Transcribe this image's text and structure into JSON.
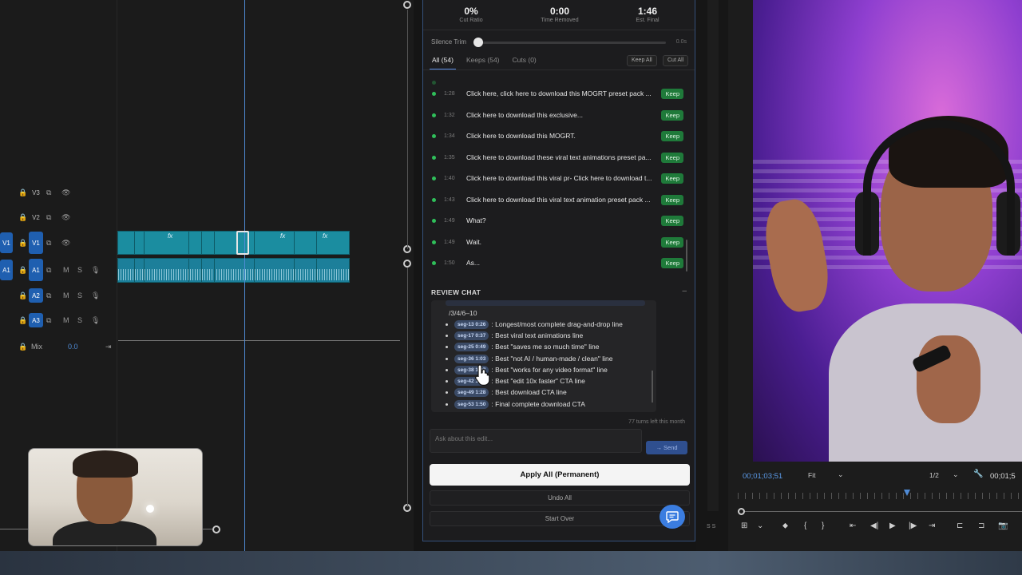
{
  "timeline": {
    "tracks": [
      {
        "id": "V3",
        "name": "V3"
      },
      {
        "id": "V2",
        "name": "V2"
      },
      {
        "id": "V1",
        "name": "V1",
        "target": "V1"
      },
      {
        "id": "A1",
        "name": "A1",
        "target": "A1",
        "m": "M",
        "s": "S"
      },
      {
        "id": "A2",
        "name": "A2",
        "m": "M",
        "s": "S"
      },
      {
        "id": "A3",
        "name": "A3",
        "m": "M",
        "s": "S"
      }
    ],
    "mix_label": "Mix",
    "mix_value": "0.0",
    "fx_label": "fx"
  },
  "panel": {
    "stats": [
      {
        "value": "0%",
        "label": "Cut Ratio"
      },
      {
        "value": "0:00",
        "label": "Time Removed"
      },
      {
        "value": "1:46",
        "label": "Est. Final"
      }
    ],
    "silence_trim_label": "Silence Trim",
    "silence_trim_value": "0.0s",
    "tabs": [
      "All (54)",
      "Keeps (54)",
      "Cuts (0)"
    ],
    "keep_all_label": "Keep All",
    "cut_all_label": "Cut All",
    "segments": [
      {
        "time": "1:28",
        "text": "Click here, click here to download this MOGRT preset pack ...",
        "status": "Keep"
      },
      {
        "time": "1:32",
        "text": "Click here to download this exclusive...",
        "status": "Keep"
      },
      {
        "time": "1:34",
        "text": "Click here to download this MOGRT.",
        "status": "Keep"
      },
      {
        "time": "1:35",
        "text": "Click here to download these viral text animations preset pa...",
        "status": "Keep"
      },
      {
        "time": "1:40",
        "text": "Click here to download this viral pr- Click here to download t...",
        "status": "Keep"
      },
      {
        "time": "1:43",
        "text": "Click here to download this viral text animation preset pack ...",
        "status": "Keep"
      },
      {
        "time": "1:49",
        "text": "What?",
        "status": "Keep"
      },
      {
        "time": "1:49",
        "text": "Wait.",
        "status": "Keep"
      },
      {
        "time": "1:50",
        "text": "As...",
        "status": "Keep"
      }
    ],
    "review_chat_title": "REVIEW CHAT",
    "review_chat_collapse": "–",
    "chat_intro": "/3/4/6–10",
    "chat_items": [
      {
        "chip": "seg-13 0:26",
        "text": ": Longest/most complete drag-and-drop line"
      },
      {
        "chip": "seg-17 0:37",
        "text": ": Best viral text animations line"
      },
      {
        "chip": "seg-25 0:49",
        "text": ": Best \"saves me so much time\" line"
      },
      {
        "chip": "seg-36 1:03",
        "text": ": Best \"not AI / human-made / clean\" line"
      },
      {
        "chip": "seg-38 1:07",
        "text": ": Best \"works for any video format\" line"
      },
      {
        "chip": "seg-42 1:15",
        "text": ": Best \"edit 10x faster\" CTA line"
      },
      {
        "chip": "seg-49 1:28",
        "text": ": Best download CTA line"
      },
      {
        "chip": "seg-53 1:50",
        "text": ": Final complete download CTA"
      }
    ],
    "turns_left": "77 turns left this month",
    "ask_placeholder": "Ask about this edit...",
    "send_label": "→ Send",
    "apply_label": "Apply All (Permanent)",
    "undo_label": "Undo All",
    "start_over_label": "Start Over"
  },
  "strip_label": "S S",
  "program": {
    "timecode": "00;01;03;51",
    "fit_label": "Fit",
    "resolution": "1/2",
    "timecode_right": "00;01;5"
  },
  "colors": {
    "accent_blue": "#3b7de0",
    "keep_green": "#1f7a3a",
    "clip_teal": "#1b8da0",
    "timecode_blue": "#5b9ae8"
  }
}
